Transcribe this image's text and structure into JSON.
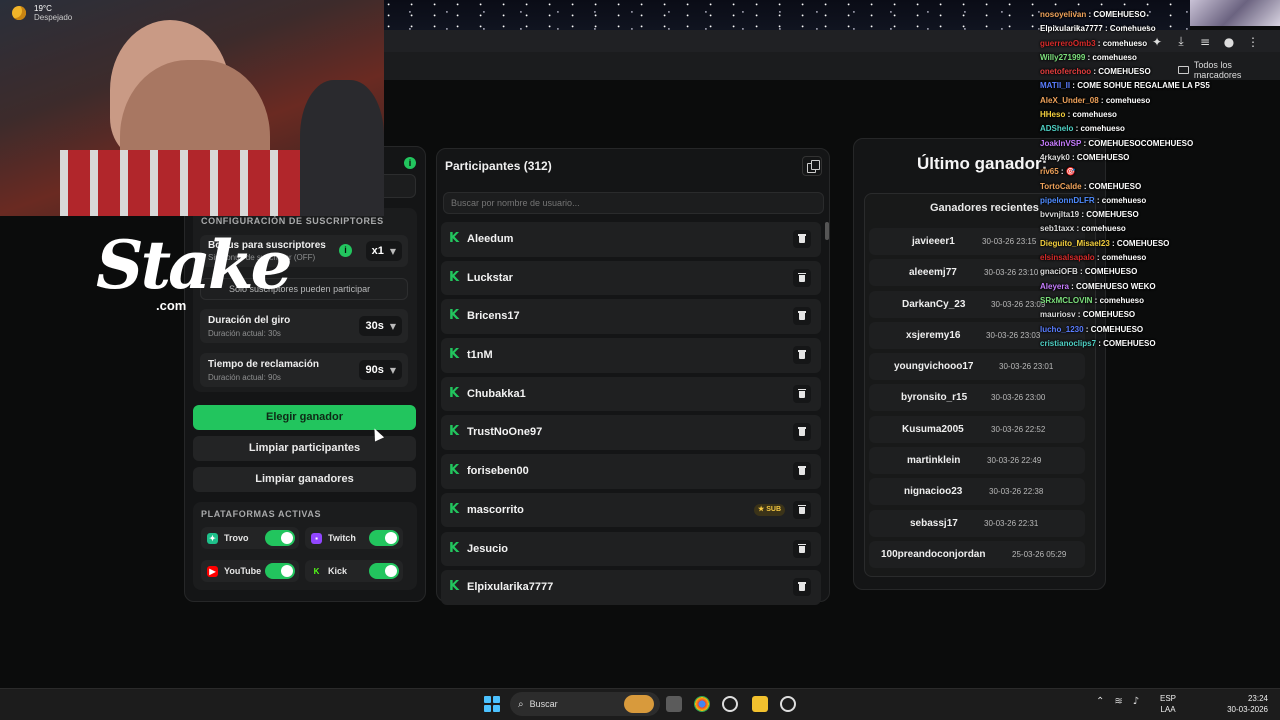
{
  "browser": {
    "bookmarks_folder": "Todos los marcadores",
    "icons": [
      "puzzle-icon",
      "download-icon",
      "playlist-icon",
      "profile-icon",
      "menu-icon"
    ]
  },
  "logo": {
    "word": "Stake",
    "suffix": ".com"
  },
  "subscribers": {
    "section_title": "CONFIGURACIÓN DE SUSCRIPTORES",
    "bonus_label": "Bonus para suscriptores",
    "bonus_sub": "Sin bonus de suscriptor (OFF)",
    "bonus_value": "x1",
    "sub_only_text": "Solo suscriptores pueden participar",
    "spin_label": "Duración del giro",
    "spin_sub": "Duración actual: 30s",
    "spin_value": "30s",
    "claim_label": "Tiempo de reclamación",
    "claim_sub": "Duración actual: 90s",
    "claim_value": "90s"
  },
  "actions": {
    "pick_winner": "Elegir ganador",
    "clear_participants": "Limpiar participantes",
    "clear_winners": "Limpiar ganadores"
  },
  "platforms": {
    "section_title": "PLATAFORMAS ACTIVAS",
    "items": [
      {
        "name": "Trovo",
        "enabled": true,
        "color": "#1ec08a"
      },
      {
        "name": "Twitch",
        "enabled": true,
        "color": "#9146ff"
      },
      {
        "name": "YouTube",
        "enabled": true,
        "color": "#ff0000"
      },
      {
        "name": "Kick",
        "enabled": true,
        "color": "#53fc18"
      }
    ]
  },
  "participants": {
    "title": "Participantes (312)",
    "search_placeholder": "Buscar por nombre de usuario...",
    "sub_badge": "SUB",
    "items": [
      {
        "name": "Aleedum",
        "sub": false
      },
      {
        "name": "Luckstar",
        "sub": false
      },
      {
        "name": "Bricens17",
        "sub": false
      },
      {
        "name": "t1nM",
        "sub": false
      },
      {
        "name": "Chubakka1",
        "sub": false
      },
      {
        "name": "TrustNoOne97",
        "sub": false
      },
      {
        "name": "foriseben00",
        "sub": false
      },
      {
        "name": "mascorrito",
        "sub": true
      },
      {
        "name": "Jesucio",
        "sub": false
      },
      {
        "name": "Elpixularika7777",
        "sub": false
      }
    ]
  },
  "winner": {
    "title": "Último ganador:",
    "recent_title": "Ganadores recientes",
    "recent": [
      {
        "name": "javieeer1",
        "date": "30-03-26 23:15"
      },
      {
        "name": "aleeemj77",
        "date": "30-03-26 23:10"
      },
      {
        "name": "DarkanCy_23",
        "date": "30-03-26 23:09"
      },
      {
        "name": "xsjeremy16",
        "date": "30-03-26 23:03"
      },
      {
        "name": "youngvichooo17",
        "date": "30-03-26 23:01"
      },
      {
        "name": "byronsito_r15",
        "date": "30-03-26 23:00"
      },
      {
        "name": "Kusuma2005",
        "date": "30-03-26 22:52"
      },
      {
        "name": "martinklein",
        "date": "30-03-26 22:49"
      },
      {
        "name": "nignacioo23",
        "date": "30-03-26 22:38"
      },
      {
        "name": "sebassj17",
        "date": "30-03-26 22:31"
      },
      {
        "name": "100preandoconjordan",
        "date": "25-03-26 05:29"
      }
    ]
  },
  "chat": [
    {
      "user": "nosoyelivan",
      "msg": "COMEHUESO",
      "color": "#f0a35b"
    },
    {
      "user": "Elpixularika7777",
      "msg": "Comehueso",
      "color": "#ffffff"
    },
    {
      "user": "guerreroOmb3",
      "msg": "comehueso",
      "color": "#d92b2b"
    },
    {
      "user": "Willy271999",
      "msg": "comehueso",
      "color": "#7ce07c"
    },
    {
      "user": "onetoferchoo",
      "msg": "COMEHUESO",
      "color": "#e23e3e"
    },
    {
      "user": "MATII_II",
      "msg": "COME SOHUE REGALAME LA PS5",
      "color": "#5a7dff"
    },
    {
      "user": "AleX_Under_08",
      "msg": "comehueso",
      "color": "#f0a35b"
    },
    {
      "user": "HHeso",
      "msg": "comehueso",
      "color": "#f4d03f"
    },
    {
      "user": "ADShelo",
      "msg": "comehueso",
      "color": "#4fd1c5"
    },
    {
      "user": "JoakInVSP",
      "msg": "COMEHUESOCOMEHUESO",
      "color": "#c77dff"
    },
    {
      "user": "4rkayk0",
      "msg": "COMEHUESO",
      "color": "#dddddd"
    },
    {
      "user": "riv65",
      "msg": "🎯",
      "color": "#f0a35b"
    },
    {
      "user": "TortoCalde",
      "msg": "COMEHUESO",
      "color": "#f0a35b"
    },
    {
      "user": "pipelonnDLFR",
      "msg": "comehueso",
      "color": "#4f8cff"
    },
    {
      "user": "bvvnjlta19",
      "msg": "COMEHUESO",
      "color": "#dddddd"
    },
    {
      "user": "seb1taxx",
      "msg": "comehueso",
      "color": "#dddddd"
    },
    {
      "user": "Dieguito_Misael23",
      "msg": "COMEHUESO",
      "color": "#f4d03f"
    },
    {
      "user": "elsinsalsapalo",
      "msg": "comehueso",
      "color": "#d92b2b"
    },
    {
      "user": "gnaciOFB",
      "msg": "COMEHUESO",
      "color": "#dddddd"
    },
    {
      "user": "Aleyera",
      "msg": "COMEHUESO WEKO",
      "color": "#c77dff"
    },
    {
      "user": "SRxMCLOVIN",
      "msg": "comehueso",
      "color": "#7ce07c"
    },
    {
      "user": "mauriosv",
      "msg": "COMEHUESO",
      "color": "#dddddd"
    },
    {
      "user": "lucho_1230",
      "msg": "COMEHUESO",
      "color": "#5a7dff"
    },
    {
      "user": "cristianoclips7",
      "msg": "COMEHUESO",
      "color": "#4fd1c5"
    }
  ],
  "taskbar": {
    "temp": "19°C",
    "weather": "Despejado",
    "search": "Buscar",
    "lang_1": "ESP",
    "lang_2": "LAA",
    "time": "23:24",
    "date": "30-03-2026"
  }
}
